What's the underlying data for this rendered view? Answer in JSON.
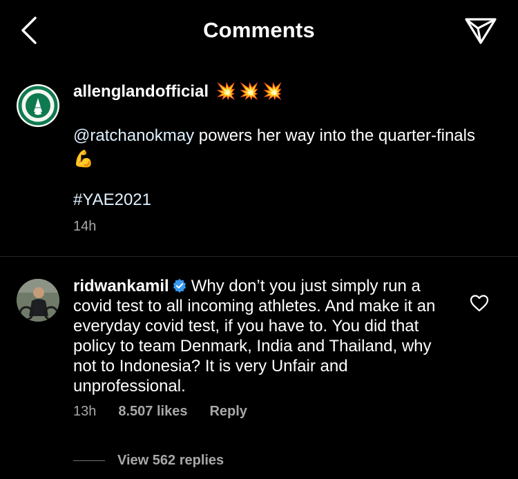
{
  "header": {
    "title": "Comments"
  },
  "caption": {
    "username": "allenglandofficial",
    "mention": "@ratchanokmay",
    "text": " powers her way into the quarter-finals",
    "emoji": "💪",
    "hashtag": "#YAE2021",
    "time": "14h",
    "burst_emoji": [
      "💥",
      "💥",
      "💥"
    ]
  },
  "comment": {
    "username": "ridwankamil",
    "text": "Why don’t you just simply run a covid test to all incoming athletes. And make it an everyday covid test, if you have to. You did that policy to team Denmark, India and Thailand, why not to Indonesia? It is very Unfair and unprofessional.",
    "time": "13h",
    "likes": "8.507 likes",
    "reply_label": "Reply",
    "view_replies": "View 562 replies"
  },
  "colors": {
    "background": "#000000",
    "secondary_text": "#a8a8a8",
    "verified": "#3897f0",
    "burst": "#ff3b1f"
  }
}
